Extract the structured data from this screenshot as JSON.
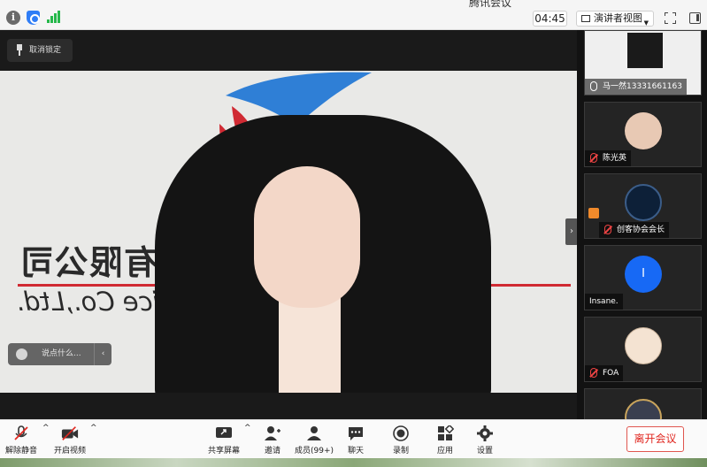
{
  "app": {
    "title_fragment": "腾讯会议"
  },
  "topbar": {
    "timer": "04:45",
    "view_label": "演讲者视图",
    "colors": {
      "shield": "#2f7df6",
      "signal": "#25b84a"
    }
  },
  "stage": {
    "unlock_label": "取消锁定",
    "chat_placeholder": "说点什么...",
    "logo_cn": "吉林省渠道服务有限公司",
    "logo_en": "Jilin Jucai Service Co.,Ltd.",
    "collapse_glyph": "›"
  },
  "participants": [
    {
      "name": "马一然13331661163",
      "mic": "on",
      "avatar_color": "#c9c9c9"
    },
    {
      "name": "陈光英",
      "mic": "muted",
      "avatar_color": "#e8c9b4"
    },
    {
      "name": "创客协会会长",
      "mic": "muted",
      "host": true,
      "avatar_color": "#0d2038"
    },
    {
      "name": "Insane.",
      "mic": "none",
      "avatar_letter": "I",
      "avatar_color": "#1769f5"
    },
    {
      "name": "FOA",
      "mic": "muted",
      "avatar_color": "#f4e3d2"
    },
    {
      "name": "",
      "mic": "none",
      "avatar_color": "#3a3f4f"
    }
  ],
  "toolbar": {
    "unmute": "解除静音",
    "start_video": "开启视频",
    "share_screen": "共享屏幕",
    "invite": "邀请",
    "members": "成员(99+)",
    "chat": "聊天",
    "record": "录制",
    "apps": "应用",
    "settings": "设置",
    "leave": "离开会议",
    "leave_color": "#e0261f"
  }
}
